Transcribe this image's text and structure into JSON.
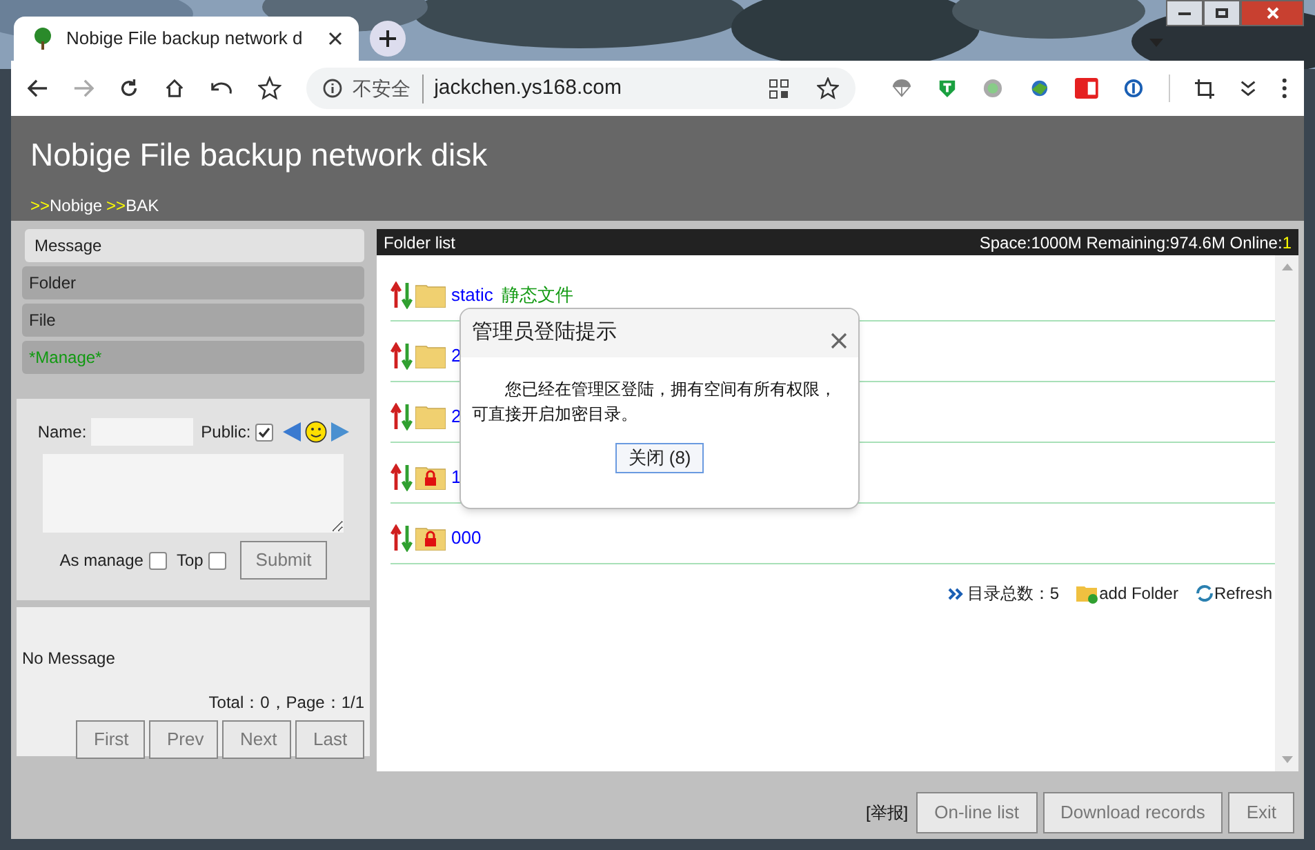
{
  "browser": {
    "tab_title": "Nobige File backup network d",
    "security": "不安全",
    "url": "jackchen.ys168.com"
  },
  "header": {
    "title": "Nobige File backup network disk",
    "breadcrumb": [
      {
        "marker": ">>",
        "label": "Nobige"
      },
      {
        "marker": ">>",
        "label": "BAK"
      }
    ]
  },
  "sidebar": {
    "items": [
      {
        "label": "Message",
        "selected": true,
        "kind": "plain"
      },
      {
        "label": "Folder",
        "selected": false,
        "kind": "plain"
      },
      {
        "label": "File",
        "selected": false,
        "kind": "plain"
      },
      {
        "label": "*Manage*",
        "selected": false,
        "kind": "manage"
      }
    ]
  },
  "message_form": {
    "name_label": "Name:",
    "public_label": "Public:",
    "public_checked": true,
    "as_manage_label": "As manage",
    "as_manage_checked": false,
    "top_label": "Top",
    "top_checked": false,
    "submit": "Submit"
  },
  "messages": {
    "empty": "No Message",
    "summary": "Total：0，Page：1/1",
    "pager": [
      "First",
      "Prev",
      "Next",
      "Last"
    ]
  },
  "folder_panel": {
    "title": "Folder list",
    "space": "Space:1000M Remaining:974.6M Online:",
    "online": "1",
    "rows": [
      {
        "name": "static",
        "desc": "静态文件",
        "locked": false
      },
      {
        "name": "2",
        "desc": "",
        "locked": false
      },
      {
        "name": "2",
        "desc": "",
        "locked": false
      },
      {
        "name": "1",
        "desc": "",
        "locked": true
      },
      {
        "name": "000",
        "desc": "",
        "locked": true
      }
    ],
    "total": "目录总数：5",
    "add_folder": "add Folder",
    "refresh": "Refresh"
  },
  "dialog": {
    "title": "管理员登陆提示",
    "message": "您已经在管理区登陆，拥有空间有所有权限，可直接开启加密目录。",
    "button": "关闭 (8)"
  },
  "footer": {
    "report": "[举报]",
    "buttons": [
      "On-line list",
      "Download records",
      "Exit"
    ]
  }
}
